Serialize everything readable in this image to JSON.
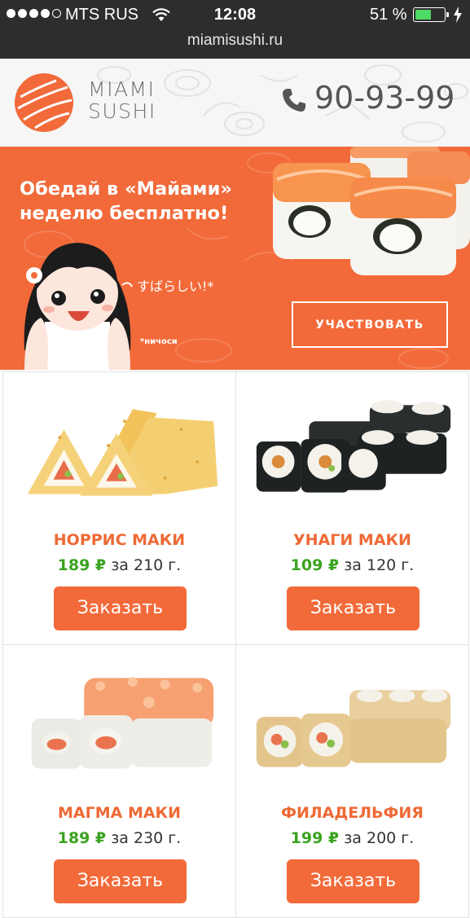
{
  "status_bar": {
    "carrier": "MTS RUS",
    "time": "12:08",
    "battery_percent": "51 %",
    "battery_level": 0.51,
    "signal_bars_filled": 4,
    "signal_bars_total": 5
  },
  "browser": {
    "url": "miamisushi.ru"
  },
  "header": {
    "logo_line1": "MIAMI",
    "logo_line2": "SUSHI",
    "phone": "90-93-99",
    "icons": {
      "phone": "phone-icon",
      "logo": "logo-mark"
    }
  },
  "banner": {
    "title_line1": "Обедай в «Майами»",
    "title_line2": "неделю бесплатно!",
    "speech": "すばらしい!*",
    "footnote": "*ничоси",
    "button": "УЧАСТВОВАТЬ"
  },
  "products": [
    {
      "name": "НОРРИС МАКИ",
      "price": "189 ₽",
      "weight": "за 210 г.",
      "button": "Заказать"
    },
    {
      "name": "УНАГИ МАКИ",
      "price": "109 ₽",
      "weight": "за 120 г.",
      "button": "Заказать"
    },
    {
      "name": "МАГМА МАКИ",
      "price": "189 ₽",
      "weight": "за 230 г.",
      "button": "Заказать"
    },
    {
      "name": "ФИЛАДЕЛЬФИЯ",
      "price": "199 ₽",
      "weight": "за 200 г.",
      "button": "Заказать"
    }
  ],
  "colors": {
    "brand_orange": "#f26a3a",
    "price_green": "#3aa31f",
    "product_name": "#ee6a35",
    "status_bar": "#2d2d2d"
  }
}
